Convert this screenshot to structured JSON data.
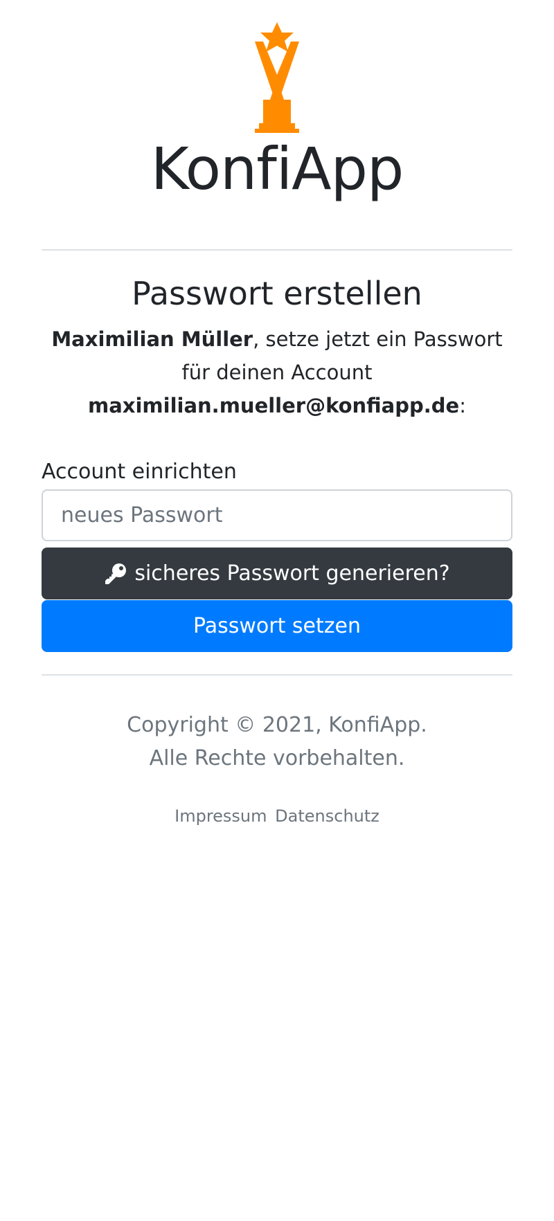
{
  "app": {
    "title": "KonfiApp",
    "logo_icon": "trophy-star-icon",
    "logo_color": "#FF8C00"
  },
  "form": {
    "heading": "Passwort erstellen",
    "intro_name": "Maximilian Müller",
    "intro_text_1": ", setze jetzt ein Passwort für deinen Account ",
    "intro_email": "maximilian.mueller@konfiapp.de",
    "intro_text_2": ":",
    "field_label": "Account einrichten",
    "password_placeholder": "neues Passwort",
    "password_value": "",
    "generate_button_label": "sicheres Passwort generieren?",
    "generate_button_icon": "key-icon",
    "submit_button_label": "Passwort setzen"
  },
  "footer": {
    "copyright_line_1": "Copyright © 2021, KonfiApp.",
    "copyright_line_2": "Alle Rechte vorbehalten.",
    "links": [
      "Impressum",
      "Datenschutz"
    ]
  },
  "colors": {
    "dark_button": "#343a40",
    "primary_button": "#007bff",
    "muted_text": "#6c757d"
  }
}
